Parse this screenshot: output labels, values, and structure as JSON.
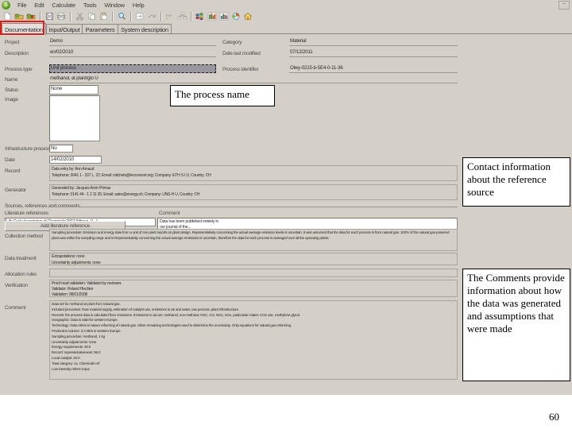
{
  "app": {
    "logo_glyph": "S",
    "close_label": "–"
  },
  "menubar": {
    "items": [
      {
        "label": "File"
      },
      {
        "label": "Edit"
      },
      {
        "label": "Calculate"
      },
      {
        "label": "Tools"
      },
      {
        "label": "Window"
      },
      {
        "label": "Help"
      }
    ]
  },
  "toolbar": {
    "icons": [
      "new-document-icon",
      "open-folder-icon",
      "open-project-icon",
      "save-icon",
      "print-icon",
      "cut-icon",
      "copy-icon",
      "paste-icon",
      "find-icon",
      "indent-icon",
      "outdent-icon",
      "calculate-icon",
      "network-icon",
      "process-tree-icon",
      "bar-chart-icon",
      "column-chart-icon",
      "pie-chart-icon",
      "home-icon"
    ]
  },
  "tabs": [
    {
      "label": "Documentation",
      "active": true
    },
    {
      "label": "Input/Output",
      "active": false
    },
    {
      "label": "Parameters",
      "active": false
    },
    {
      "label": "System description",
      "active": false
    }
  ],
  "form": {
    "project": {
      "label": "Project",
      "value": "Demo"
    },
    "category": {
      "label": "Category",
      "value": "Material"
    },
    "description_label": {
      "label": "Description",
      "value": "en/02/2010"
    },
    "last_modified": {
      "label": "Date last modified",
      "value": "07/12/2011"
    },
    "process_type": {
      "label": "Process type",
      "value": "Unit process"
    },
    "process_identifier": {
      "label": "Process identifier",
      "value": "Olwy-0215-b-5E4-0-11-36"
    },
    "name": {
      "label": "Name",
      "value": "methanol, at plant/glo U"
    },
    "status": {
      "label": "Status",
      "value": "None"
    },
    "image": {
      "label": "Image",
      "value": ""
    },
    "infrastructure": {
      "label": "Infrastructure process",
      "value": "No"
    },
    "date": {
      "label": "Date",
      "value": "14/02/2010"
    },
    "record": {
      "label": "Record",
      "value": "Data entry by: Ann Arnaud\nTelephone: 0041 1 - 337 L. 22; Email: mitchels@leoconsort.org; Company: ETH S t U, Country: CH"
    },
    "generator": {
      "label": "Generator",
      "value": "Generated by: Jacques Arvin Primus\nTelephone: 0141 44 - 1 2 11 25; Email: sales@energy.ch; Company: UNS-H U, Country: CH"
    },
    "sources_heading": {
      "label": "Sources, references and comments"
    },
    "literature_ref": {
      "label": "Literature references",
      "value": "Life Cycle Inventories of Chemicals;2007;Althaus, H.-J."
    },
    "comment_small": {
      "label": "Comment",
      "value": "Data has been published entirely in\nour journal of the..."
    },
    "add_ref_button": {
      "label": "Add literature reference"
    },
    "collection_method": {
      "label": "Collection method",
      "value": "Sampling procedure: Emission and energy data from a unit of one plant reports on plant design. Representativity concerning the actual average emission levels is uncertain. It was assumed that the data for each process is from natural gas. 100% of the natural gas-powered plant was within the sampling range and is Representativity concerning the actual average emissions is uncertain, therefore the data for each process is averaged over all the operating plants."
    },
    "data_treatment": {
      "label": "Data treatment",
      "value": "Extrapolations: none\nUncertainty adjustments: none"
    },
    "allocation_rules": {
      "label": "Allocation rules",
      "value": ""
    },
    "verification": {
      "label": "Verification",
      "value": "Proof read validation: Validated by reviewer.\nValidator: Roland Hischier\nValidation: 08/01/2008"
    },
    "comment": {
      "label": "Comment",
      "value": "Data set for methanol at plant from natural gas.\nIncluded processes: Raw material supply, estimation of catalyst use, emissions to air and water, raw process, plant infrastructure.\nRemark: the process data is calculated from emissions. Emissions to air are: methanol, non-methane VOC, CO, NOx, SOx, particulate matter, CO2 use, methylene glycol.\nGeographic: Data is valid for western Europe.\nTechnology: Data refers to steam reforming of natural gas. Other remaining technologies used to determine the uncertainty. Only equations for natural gas reforming.\nProduction volume: 3.3 Mt/a in western Europe\nSampling procedure: methanol, 1 kg\nUncertainty adjustments: none\nEnergy requirements: 30.0\nRecord: representativeness: 95.0\nLocal catalyst: 20.0\nTotal category: ca. Chemicals ref\nLow-intensity reform input"
    }
  },
  "callouts": [
    {
      "name": "callout-process-name",
      "text": "The process name"
    },
    {
      "name": "callout-contact-info",
      "text": "Contact information about the reference source"
    },
    {
      "name": "callout-comments",
      "text": "The Comments provide information about how the data was generated and assumptions that were made"
    }
  ],
  "slide": {
    "page_number": "60"
  },
  "colors": {
    "highlight": "#e01b1b",
    "window_face": "#d4d0c8",
    "field_line": "#9c9890",
    "selected_field": "#9a96a0"
  }
}
